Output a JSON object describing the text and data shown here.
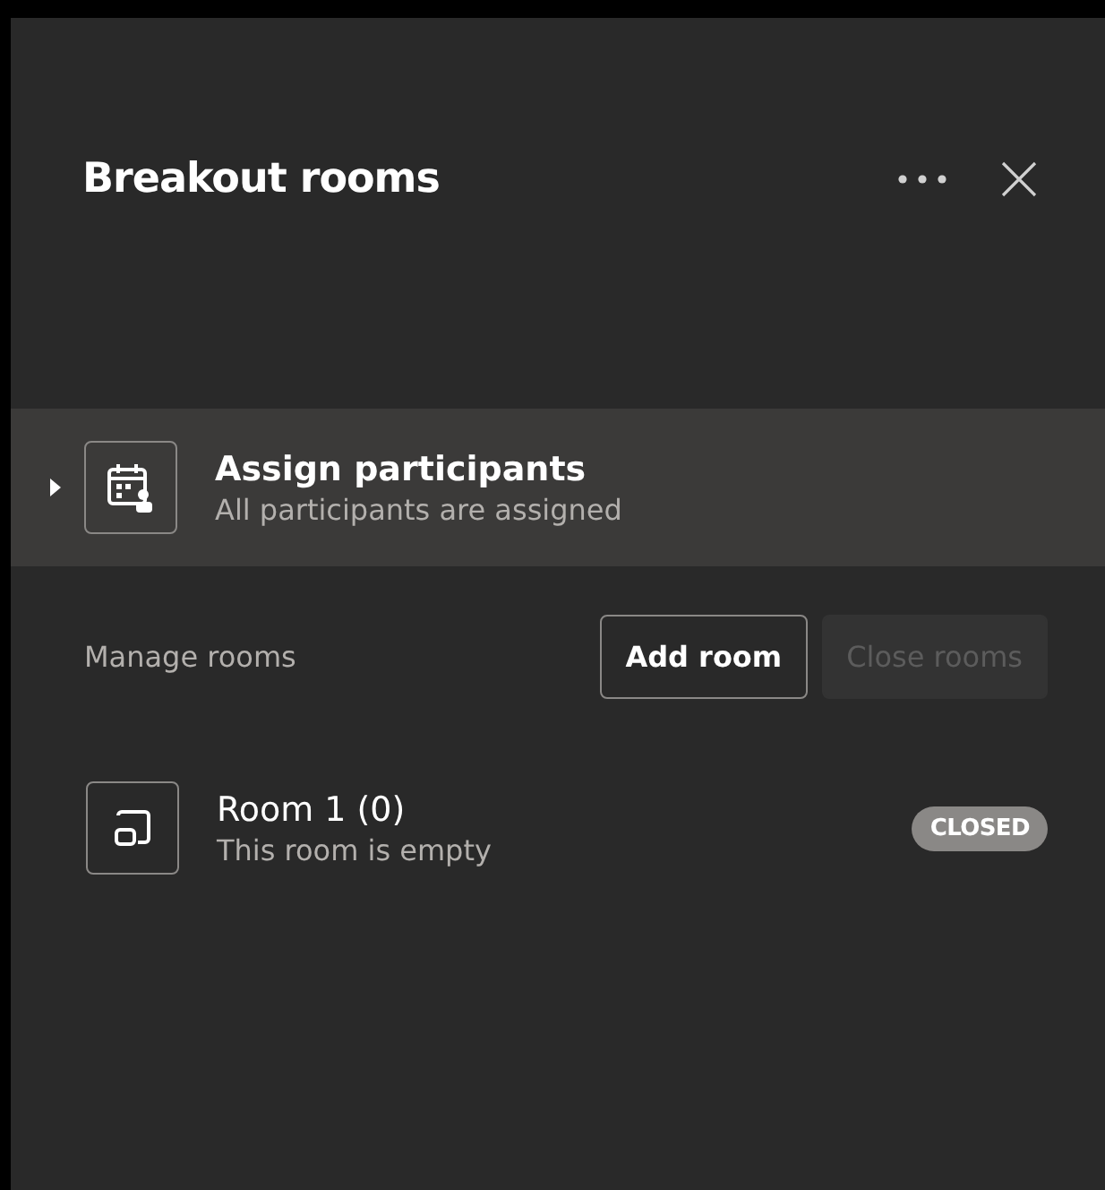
{
  "header": {
    "title": "Breakout rooms"
  },
  "assign": {
    "title": "Assign participants",
    "subtitle": "All participants are assigned",
    "expanded": false
  },
  "manage": {
    "label": "Manage rooms",
    "buttons": [
      {
        "label": "Add room",
        "disabled": false
      },
      {
        "label": "Close rooms",
        "disabled": true
      }
    ]
  },
  "rooms": [
    {
      "name": "Room 1 (0)",
      "subtitle": "This room is empty",
      "status": "CLOSED"
    }
  ]
}
